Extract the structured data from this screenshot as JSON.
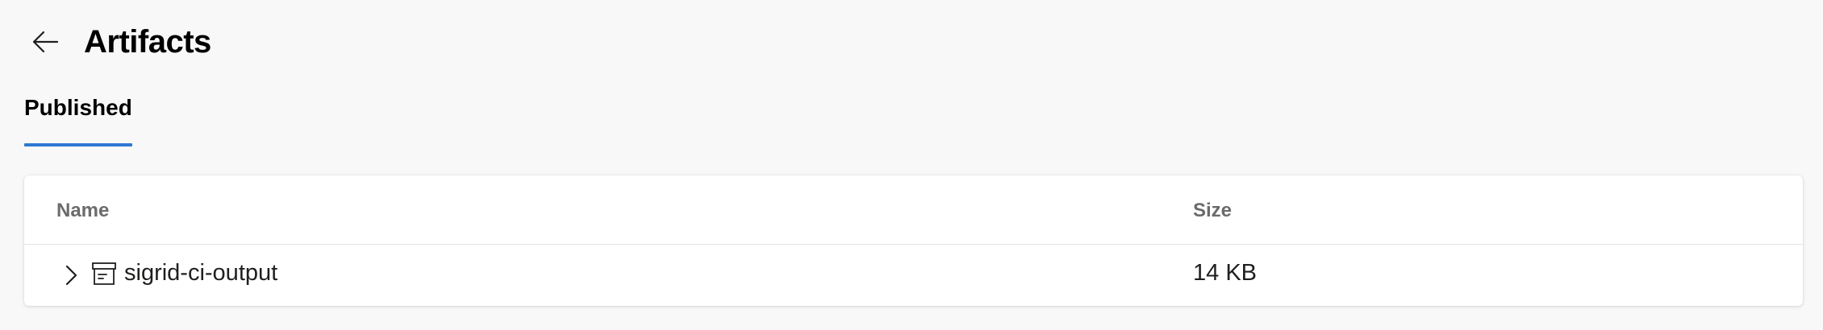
{
  "header": {
    "back_icon": "arrow-left-icon",
    "title": "Artifacts"
  },
  "tabs": [
    {
      "label": "Published",
      "selected": true
    }
  ],
  "table": {
    "columns": {
      "name": "Name",
      "size": "Size"
    },
    "rows": [
      {
        "expand_icon": "chevron-right-icon",
        "type_icon": "archive-box-icon",
        "name": "sigrid-ci-output",
        "size": "14 KB"
      }
    ]
  },
  "colors": {
    "background": "#f8f8f8",
    "card": "#ffffff",
    "accent": "#2f78d2",
    "header_text": "#6b6b6b",
    "text": "#201f1e"
  }
}
